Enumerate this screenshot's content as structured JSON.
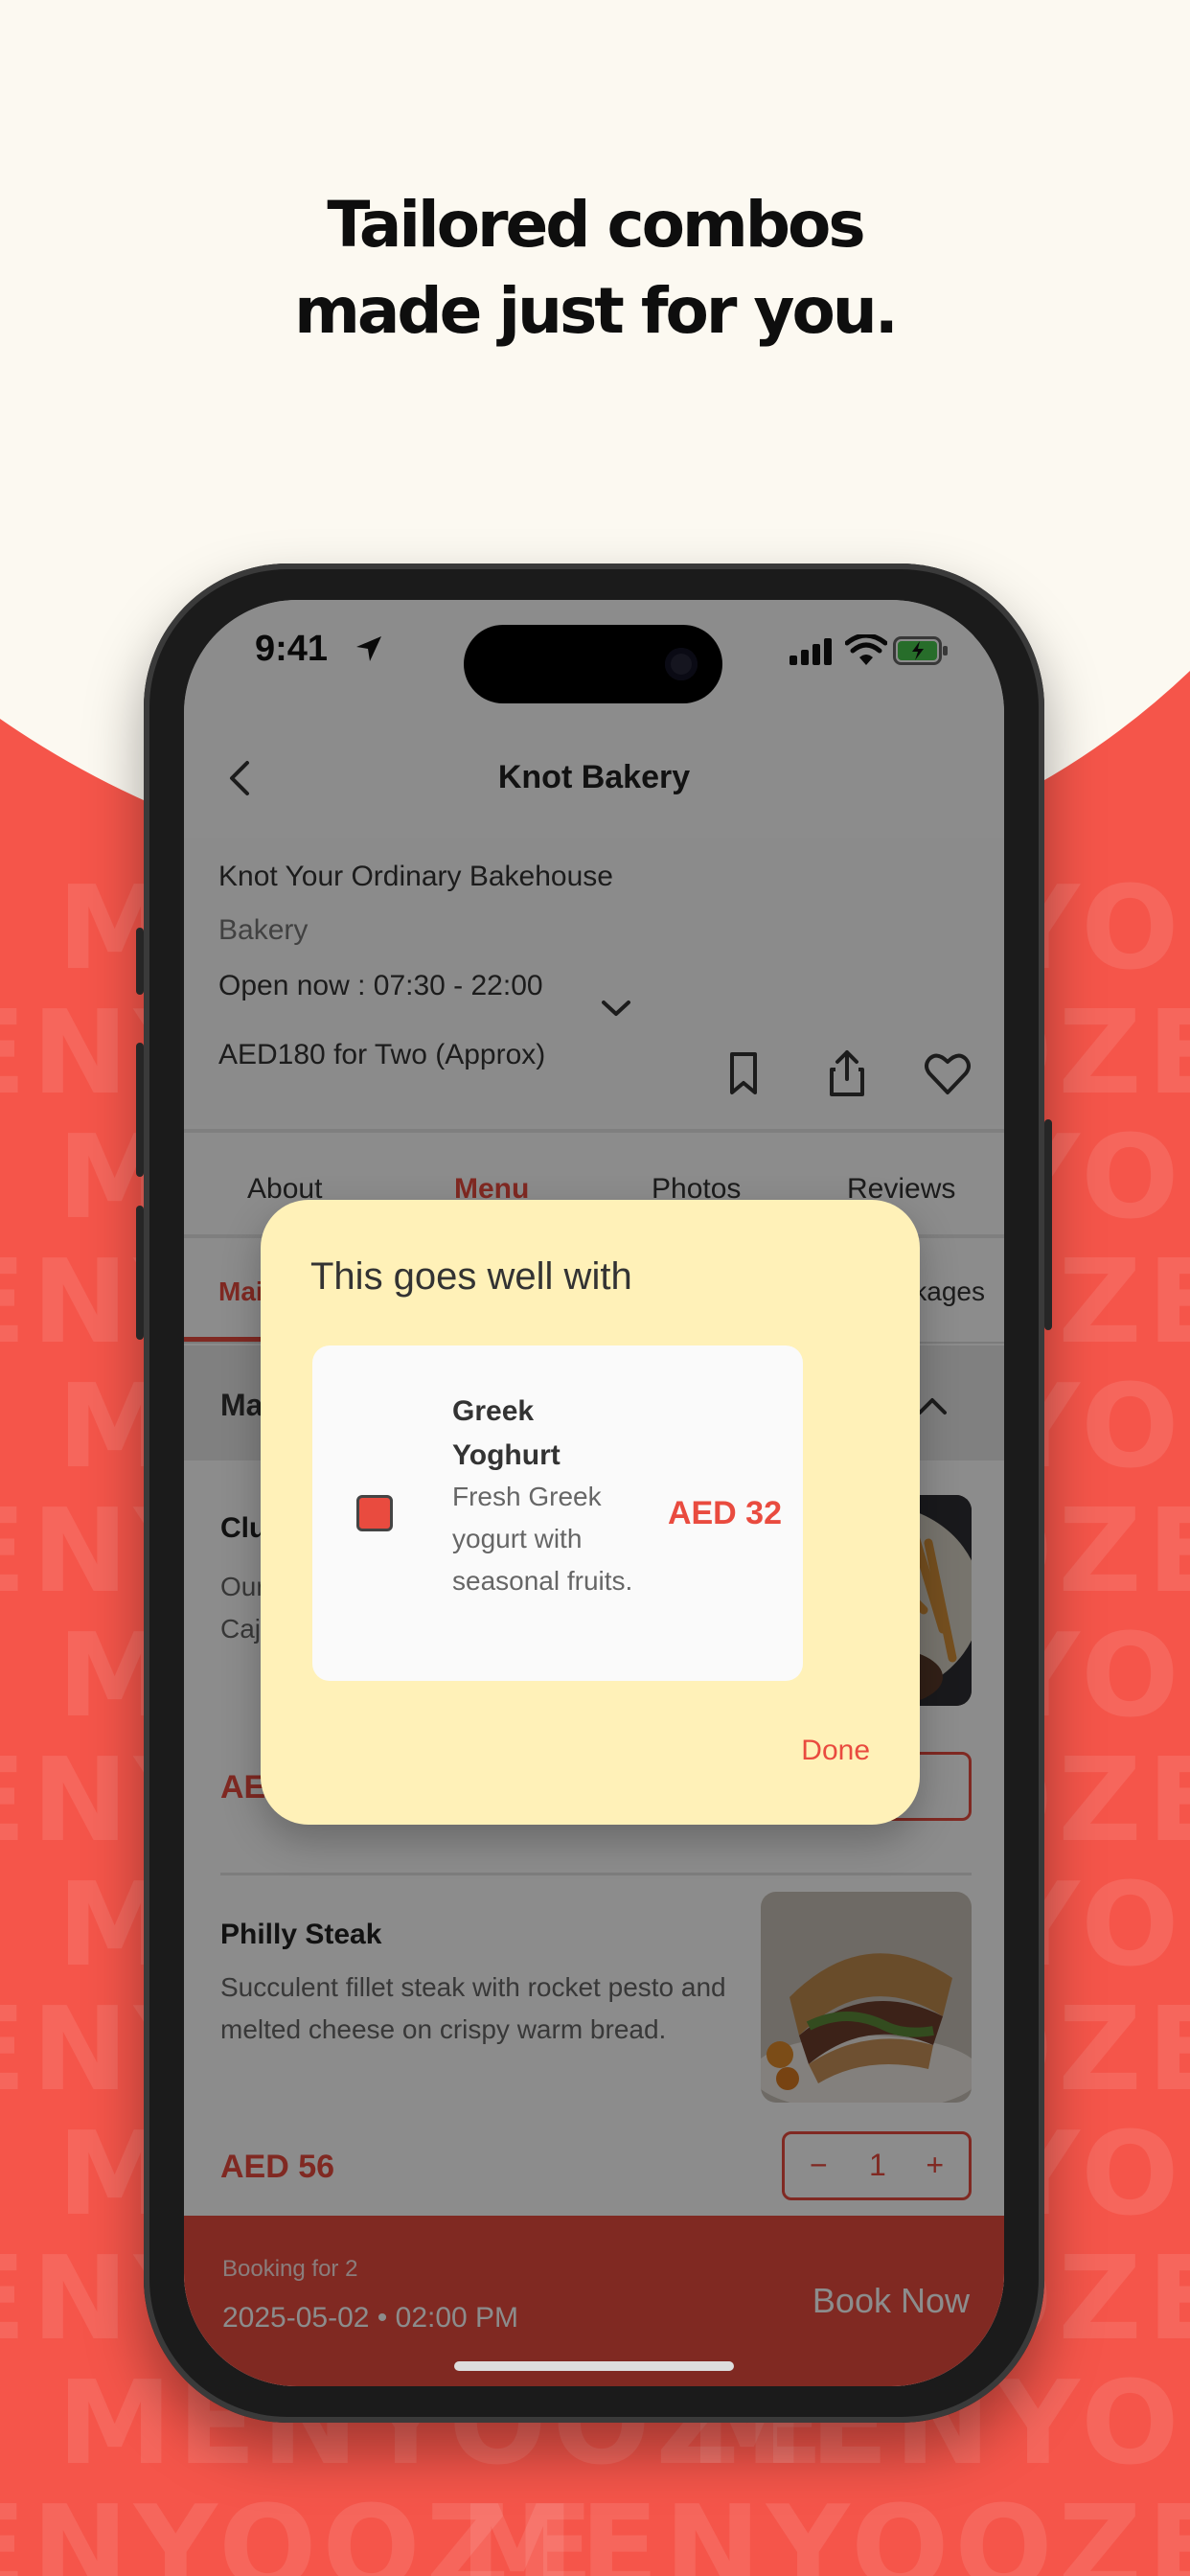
{
  "headline": {
    "line1": "Tailored combos",
    "line2": "made just for you."
  },
  "watermark": "MENYOOZE",
  "colors": {
    "brand": "#e94b3f",
    "popup_bg": "#fff1b8",
    "page_bg": "#fcf9f1"
  },
  "status_bar": {
    "time": "9:41"
  },
  "nav": {
    "back_icon": "chevron-left-icon",
    "title": "Knot Bakery"
  },
  "restaurant": {
    "name": "Knot Your Ordinary Bakehouse",
    "type": "Bakery",
    "hours": "Open now : 07:30 - 22:00",
    "cost": "AED180 for Two (Approx)"
  },
  "tabs": [
    {
      "label": "About"
    },
    {
      "label": "Menu",
      "active": true
    },
    {
      "label": "Photos"
    },
    {
      "label": "Reviews"
    }
  ],
  "categories": {
    "first": "Mains",
    "last": "ackages"
  },
  "section": {
    "title": "Main"
  },
  "items": [
    {
      "name": "Club S",
      "desc_line1": "Our ic",
      "desc_line2": "Cajun",
      "price": "AED",
      "add_label": "d"
    },
    {
      "name": "Philly Steak",
      "desc": "Succulent fillet steak with rocket pesto and melted cheese on crispy warm bread.",
      "price": "AED 56",
      "qty": "1"
    }
  ],
  "booking": {
    "label": "Booking for 2",
    "datetime": "2025-05-02 • 02:00 PM",
    "cta": "Book Now"
  },
  "popup": {
    "title": "This goes well with",
    "item": {
      "name": "Greek Yoghurt",
      "desc": "Fresh Greek yogurt with seasonal fruits.",
      "price": "AED 32",
      "selected": true
    },
    "done_label": "Done"
  }
}
